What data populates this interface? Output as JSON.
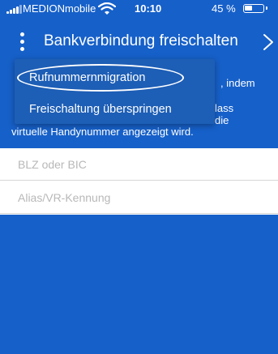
{
  "status_bar": {
    "carrier": "MEDIONmobile",
    "time": "10:10",
    "battery": "45 %",
    "icons": [
      "signal-icon",
      "wifi-icon",
      "battery-icon"
    ]
  },
  "nav": {
    "title": "Bankverbindung freischalten",
    "menu_icon": "more-vertical-icon",
    "next_icon": "chevron-right-icon"
  },
  "intro_fragments": [
    ", indem",
    "lass",
    "die",
    "virtuelle Handynummer angezeigt wird."
  ],
  "form": {
    "blz_placeholder": "BLZ oder BIC",
    "alias_placeholder": "Alias/VR-Kennung"
  },
  "dropdown": {
    "items": [
      {
        "label": "Rufnummernmigration"
      },
      {
        "label": "Freischaltung überspringen"
      }
    ]
  },
  "colors": {
    "background": "#1660C9",
    "menu": "#1d5eb6",
    "text": "#FFFFFF"
  }
}
